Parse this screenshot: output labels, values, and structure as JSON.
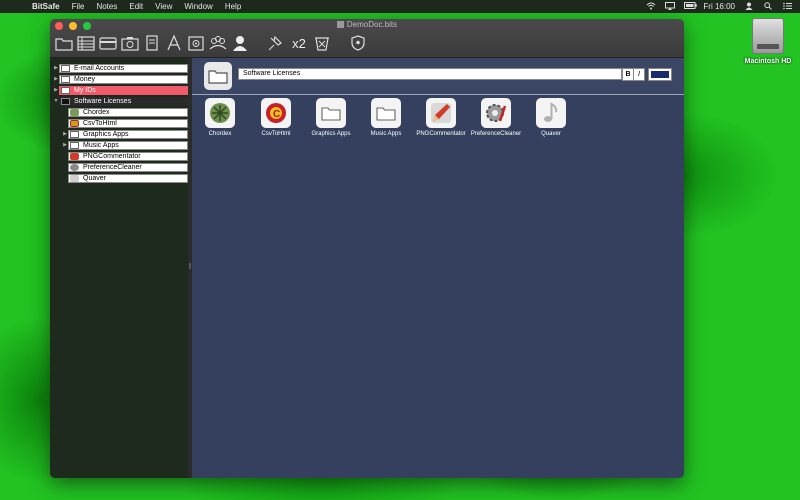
{
  "menubar": {
    "app_name": "BitSafe",
    "items": [
      "File",
      "Notes",
      "Edit",
      "View",
      "Window",
      "Help"
    ],
    "clock": "Fri 16:00"
  },
  "desktop": {
    "disk_label": "Macintosh HD"
  },
  "window": {
    "title": "DemoDoc.bits",
    "toolbar": [
      "folder-icon",
      "list-icon",
      "card-icon",
      "camera-icon",
      "note-icon",
      "font-icon",
      "safe-icon",
      "group-icon",
      "person-icon",
      "pin-icon",
      "x2",
      "trash-icon",
      "shield-icon"
    ],
    "x2_label": "x2"
  },
  "sidebar": {
    "items": [
      {
        "label": "E-mail Accounts",
        "level": 0
      },
      {
        "label": "Money",
        "level": 0
      },
      {
        "label": "My IDs",
        "level": 0
      },
      {
        "label": "Software Licenses",
        "level": 0
      },
      {
        "label": "Chordex",
        "level": 1
      },
      {
        "label": "CsvToHtml",
        "level": 1
      },
      {
        "label": "Graphics Apps",
        "level": 1
      },
      {
        "label": "Music Apps",
        "level": 1
      },
      {
        "label": "PNGCommentator",
        "level": 1
      },
      {
        "label": "PreferenceCleaner",
        "level": 1
      },
      {
        "label": "Quaver",
        "level": 1
      }
    ]
  },
  "main": {
    "title_value": "Software Licenses",
    "bold_label": "B",
    "italic_label": "I",
    "color": "#1a2a6e",
    "tiles": [
      {
        "name": "Chordex"
      },
      {
        "name": "CsvToHtml"
      },
      {
        "name": "Graphics Apps"
      },
      {
        "name": "Music Apps"
      },
      {
        "name": "PNGCommentator"
      },
      {
        "name": "PreferenceCleaner"
      },
      {
        "name": "Quaver"
      }
    ]
  }
}
